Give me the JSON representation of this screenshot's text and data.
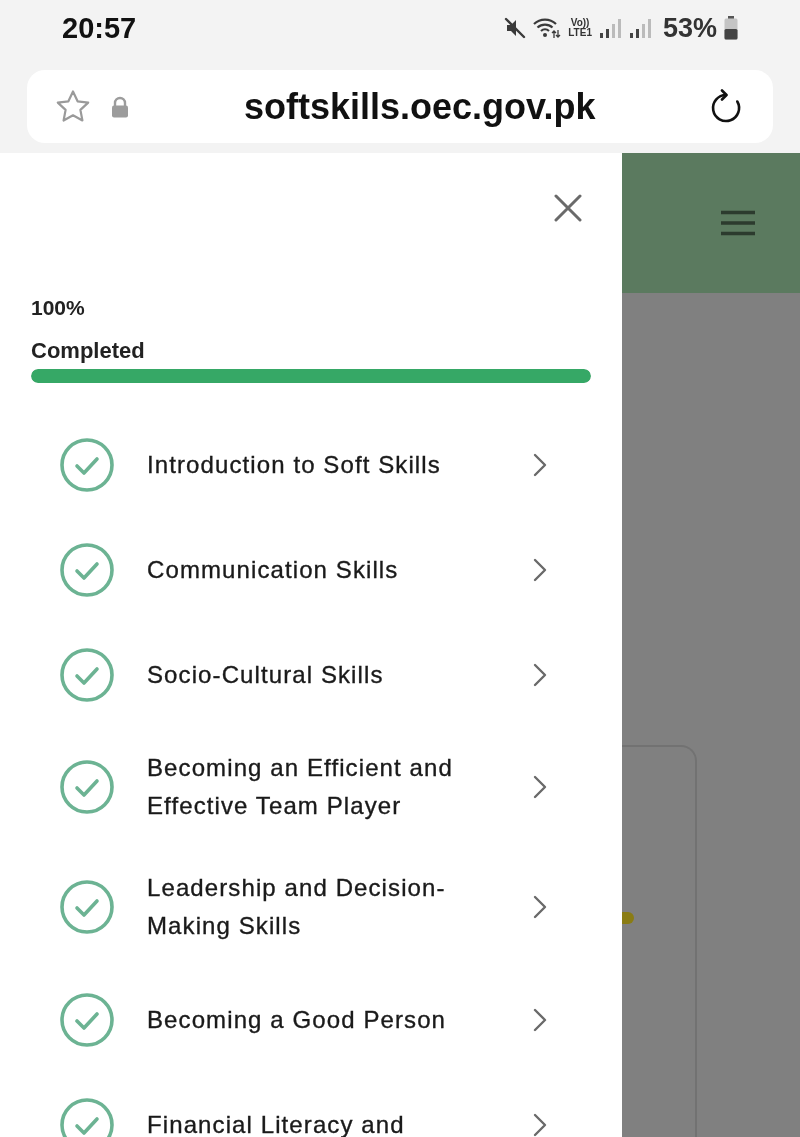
{
  "status_bar": {
    "time": "20:57",
    "network_label_top": "Vo))",
    "network_label_bottom": "LTE1",
    "battery": "53%"
  },
  "address_bar": {
    "url": "softskills.oec.gov.pk"
  },
  "drawer": {
    "progress": {
      "percent": "100%",
      "label": "Completed",
      "level": 1
    },
    "lessons": [
      {
        "title": "Introduction to Soft Skills",
        "completed": true
      },
      {
        "title": "Communication Skills",
        "completed": true
      },
      {
        "title": "Socio-Cultural Skills",
        "completed": true
      },
      {
        "title": "Becoming an Efficient and Effective Team Player",
        "completed": true
      },
      {
        "title": "Leadership and Decision-Making Skills",
        "completed": true
      },
      {
        "title": "Becoming a Good Person",
        "completed": true
      },
      {
        "title": "Financial Literacy and",
        "completed": true
      }
    ]
  }
}
